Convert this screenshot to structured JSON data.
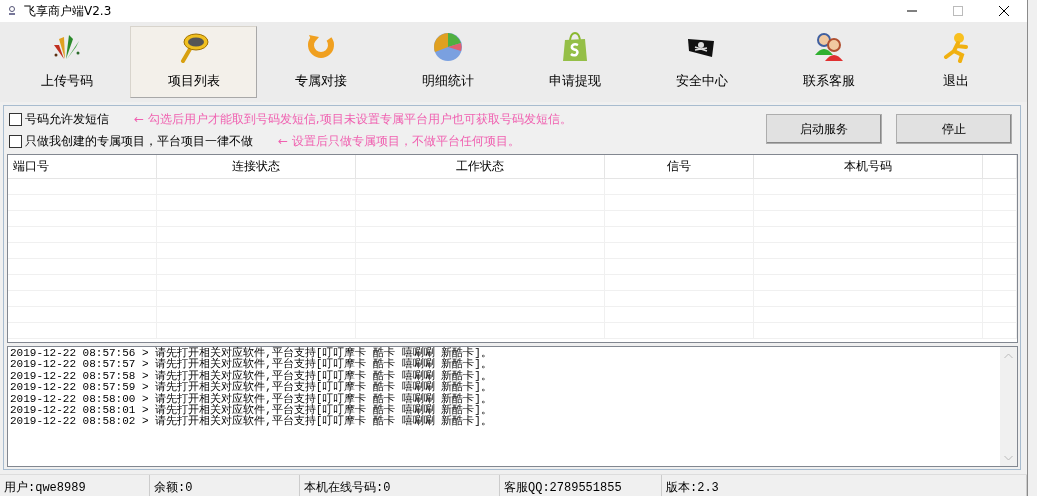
{
  "window": {
    "title": "飞享商户端V2.3"
  },
  "toolbar": [
    {
      "label": "上传号码",
      "selected": false
    },
    {
      "label": "项目列表",
      "selected": true
    },
    {
      "label": "专属对接",
      "selected": false
    },
    {
      "label": "明细统计",
      "selected": false
    },
    {
      "label": "申请提现",
      "selected": false
    },
    {
      "label": "安全中心",
      "selected": false
    },
    {
      "label": "联系客服",
      "selected": false
    },
    {
      "label": "退出",
      "selected": false
    }
  ],
  "options": [
    {
      "label": "号码允许发短信",
      "checked": false,
      "hint": "←  勾选后用户才能取到号码发短信,项目未设置专属平台用户也可获取号码发短信。"
    },
    {
      "label": "只做我创建的专属项目，平台项目一律不做",
      "checked": false,
      "hint": "←  设置后只做专属项目，不做平台任何项目。"
    }
  ],
  "buttons": [
    "启动服务",
    "停止"
  ],
  "table": {
    "columns": [
      "端口号",
      "连接状态",
      "工作状态",
      "信号",
      "本机号码"
    ]
  },
  "log": [
    "2019-12-22 08:57:56 > 请先打开相关对应软件,平台支持[叮叮摩卡 酷卡 嘻唰唰 新酷卡]。",
    "2019-12-22 08:57:57 > 请先打开相关对应软件,平台支持[叮叮摩卡 酷卡 嘻唰唰 新酷卡]。",
    "2019-12-22 08:57:58 > 请先打开相关对应软件,平台支持[叮叮摩卡 酷卡 嘻唰唰 新酷卡]。",
    "2019-12-22 08:57:59 > 请先打开相关对应软件,平台支持[叮叮摩卡 酷卡 嘻唰唰 新酷卡]。",
    "2019-12-22 08:58:00 > 请先打开相关对应软件,平台支持[叮叮摩卡 酷卡 嘻唰唰 新酷卡]。",
    "2019-12-22 08:58:01 > 请先打开相关对应软件,平台支持[叮叮摩卡 酷卡 嘻唰唰 新酷卡]。",
    "2019-12-22 08:58:02 > 请先打开相关对应软件,平台支持[叮叮摩卡 酷卡 嘻唰唰 新酷卡]。"
  ],
  "status_bar": [
    "用户:qwe8989",
    "余额:0",
    "本机在线号码:0",
    "客服QQ:2789551855",
    "版本:2.3"
  ]
}
